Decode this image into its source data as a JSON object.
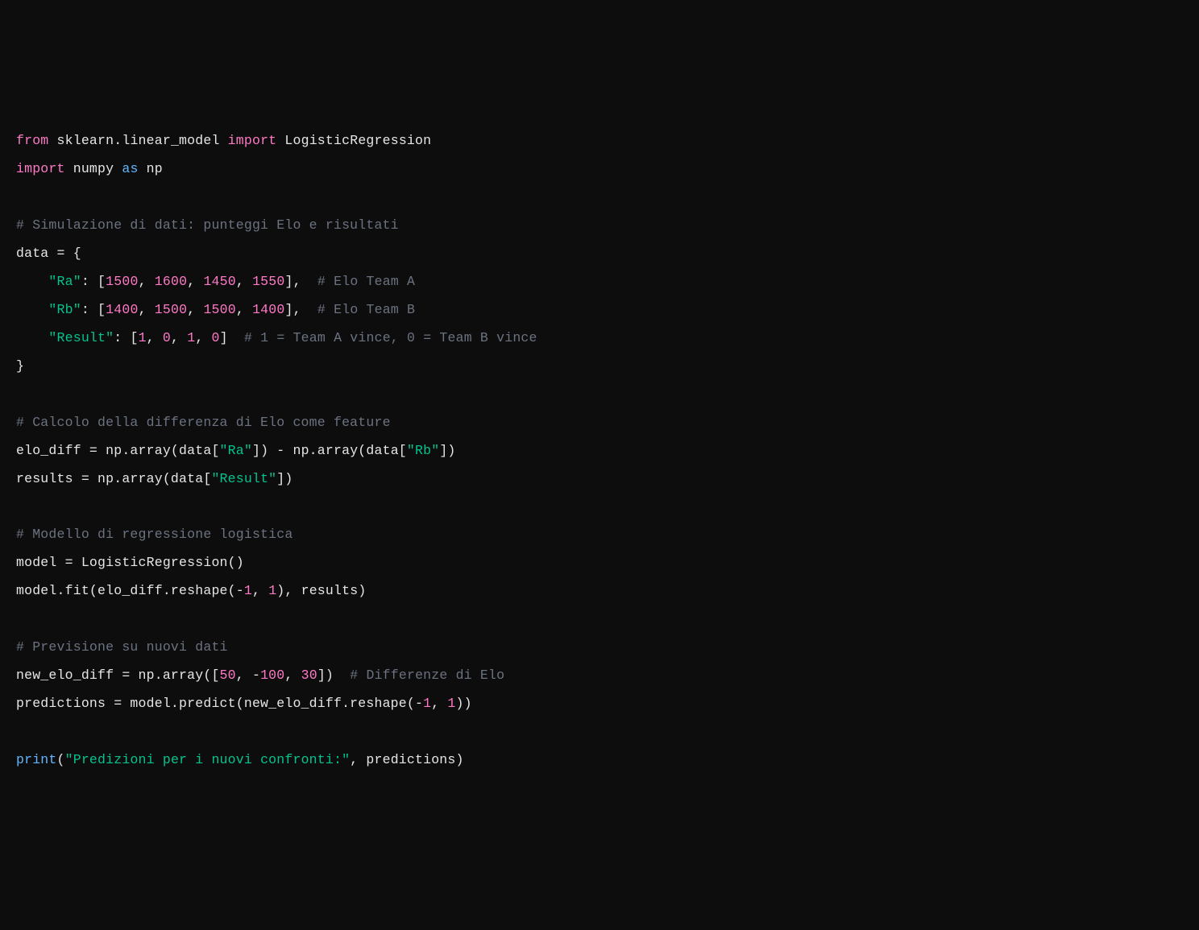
{
  "code": {
    "l1_from": "from",
    "l1_mod": " sklearn.linear_model ",
    "l1_import": "import",
    "l1_cls": " LogisticRegression",
    "l2_import": "import",
    "l2_mod": " numpy ",
    "l2_as": "as",
    "l2_alias": " np",
    "l3_empty": "",
    "l4_comment": "# Simulazione di dati: punteggi Elo e risultati",
    "l5_text": "data = {",
    "l6_indent": "    ",
    "l6_key": "\"Ra\"",
    "l6_mid1": ": [",
    "l6_n1": "1500",
    "l6_c1": ", ",
    "l6_n2": "1600",
    "l6_c2": ", ",
    "l6_n3": "1450",
    "l6_c3": ", ",
    "l6_n4": "1550",
    "l6_close": "],  ",
    "l6_comment": "# Elo Team A",
    "l7_indent": "    ",
    "l7_key": "\"Rb\"",
    "l7_mid1": ": [",
    "l7_n1": "1400",
    "l7_c1": ", ",
    "l7_n2": "1500",
    "l7_c2": ", ",
    "l7_n3": "1500",
    "l7_c3": ", ",
    "l7_n4": "1400",
    "l7_close": "],  ",
    "l7_comment": "# Elo Team B",
    "l8_indent": "    ",
    "l8_key": "\"Result\"",
    "l8_mid1": ": [",
    "l8_n1": "1",
    "l8_c1": ", ",
    "l8_n2": "0",
    "l8_c2": ", ",
    "l8_n3": "1",
    "l8_c3": ", ",
    "l8_n4": "0",
    "l8_close": "]  ",
    "l8_comment": "# 1 = Team A vince, 0 = Team B vince",
    "l9_text": "}",
    "l10_empty": "",
    "l11_comment": "# Calcolo della differenza di Elo come feature",
    "l12_a": "elo_diff = np.array(data[",
    "l12_s1": "\"Ra\"",
    "l12_b": "]) - np.array(data[",
    "l12_s2": "\"Rb\"",
    "l12_c": "])",
    "l13_a": "results = np.array(data[",
    "l13_s1": "\"Result\"",
    "l13_b": "])",
    "l14_empty": "",
    "l15_comment": "# Modello di regressione logistica",
    "l16_text": "model = LogisticRegression()",
    "l17_a": "model.fit(elo_diff.reshape(-",
    "l17_n1": "1",
    "l17_b": ", ",
    "l17_n2": "1",
    "l17_c": "), results)",
    "l18_empty": "",
    "l19_comment": "# Previsione su nuovi dati",
    "l20_a": "new_elo_diff = np.array([",
    "l20_n1": "50",
    "l20_c1": ", -",
    "l20_n2": "100",
    "l20_c2": ", ",
    "l20_n3": "30",
    "l20_b": "])  ",
    "l20_comment": "# Differenze di Elo",
    "l21_a": "predictions = model.predict(new_elo_diff.reshape(-",
    "l21_n1": "1",
    "l21_b": ", ",
    "l21_n2": "1",
    "l21_c": "))",
    "l22_empty": "",
    "l23_fn": "print",
    "l23_a": "(",
    "l23_s": "\"Predizioni per i nuovi confronti:\"",
    "l23_b": ", predictions)"
  }
}
